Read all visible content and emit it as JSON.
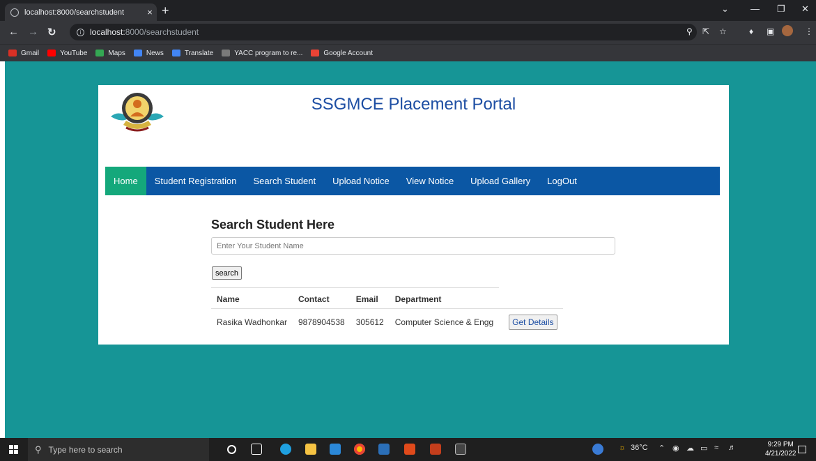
{
  "browser": {
    "tab_title": "localhost:8000/searchstudent",
    "tab_close": "×",
    "new_tab": "+",
    "url_host": "localhost:",
    "url_path": "8000/searchstudent",
    "bookmarks": [
      {
        "label": "Gmail",
        "color": "#d93025"
      },
      {
        "label": "YouTube",
        "color": "#ff0000"
      },
      {
        "label": "Maps",
        "color": "#34a853"
      },
      {
        "label": "News",
        "color": "#4285f4"
      },
      {
        "label": "Translate",
        "color": "#4285f4"
      },
      {
        "label": "YACC program to re...",
        "color": "#7a7a7a"
      },
      {
        "label": "Google Account",
        "color": "#ea4335"
      }
    ]
  },
  "site": {
    "title": "SSGMCE Placement Portal",
    "nav": [
      "Home",
      "Student Registration",
      "Search Student",
      "Upload Notice",
      "View Notice",
      "Upload Gallery",
      "LogOut"
    ],
    "active_nav": "Home",
    "colors": {
      "background": "#169596",
      "nav": "#0b57a4",
      "nav_active": "#14a87b",
      "title": "#1d4ea3"
    }
  },
  "search": {
    "heading": "Search Student Here",
    "placeholder": "Enter Your Student Name",
    "value": "",
    "button": "search"
  },
  "results": {
    "headers": [
      "Name",
      "Contact",
      "Email",
      "Department"
    ],
    "rows": [
      {
        "name": "Rasika Wadhonkar",
        "contact": "9878904538",
        "email": "305612",
        "department": "Computer Science & Engg",
        "action": "Get Details"
      }
    ]
  },
  "taskbar": {
    "search_placeholder": "Type here to search",
    "weather": "36°C",
    "time": "9:29 PM",
    "date": "4/21/2022"
  }
}
